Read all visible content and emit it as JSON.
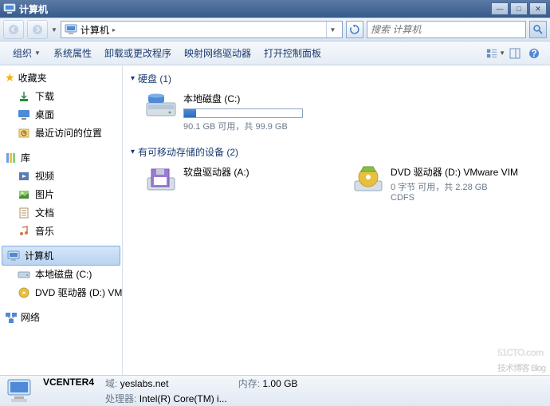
{
  "title": "计算机",
  "nav": {
    "breadcrumb": "计算机"
  },
  "search": {
    "placeholder": "搜索 计算机"
  },
  "toolbar": {
    "organize": "组织",
    "properties": "系统属性",
    "uninstall": "卸载或更改程序",
    "mapdrive": "映射网络驱动器",
    "controlpanel": "打开控制面板"
  },
  "sidebar": {
    "favorites": "收藏夹",
    "fav_items": [
      {
        "label": "下载"
      },
      {
        "label": "桌面"
      },
      {
        "label": "最近访问的位置"
      }
    ],
    "libraries": "库",
    "lib_items": [
      {
        "label": "视频"
      },
      {
        "label": "图片"
      },
      {
        "label": "文档"
      },
      {
        "label": "音乐"
      }
    ],
    "computer": "计算机",
    "comp_items": [
      {
        "label": "本地磁盘 (C:)"
      },
      {
        "label": "DVD 驱动器 (D:) VM"
      }
    ],
    "network": "网络"
  },
  "main": {
    "hdd_section": "硬盘 (1)",
    "hdds": [
      {
        "name": "本地磁盘 (C:)",
        "free_text": "90.1 GB 可用，共 99.9 GB",
        "fill_pct": 10
      }
    ],
    "removable_section": "有可移动存储的设备 (2)",
    "removables": [
      {
        "type": "floppy",
        "name": "软盘驱动器 (A:)"
      },
      {
        "type": "dvd",
        "name": "DVD 驱动器 (D:) VMware VIM",
        "sub1": "0 字节 可用，共 2.28 GB",
        "sub2": "CDFS"
      }
    ]
  },
  "status": {
    "name": "VCENTER4",
    "domain_label": "域:",
    "domain": "yeslabs.net",
    "mem_label": "内存:",
    "mem": "1.00 GB",
    "cpu_label": "处理器:",
    "cpu": "Intel(R) Core(TM) i..."
  },
  "watermark": {
    "main": "51CTO.com",
    "sub": "技术博客  Blog"
  }
}
